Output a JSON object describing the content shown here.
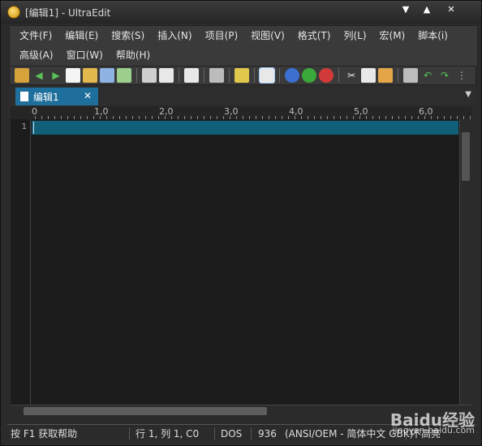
{
  "window": {
    "title": "[编辑1] - UltraEdit"
  },
  "menus": {
    "row1": [
      "文件(F)",
      "编辑(E)",
      "搜索(S)",
      "插入(N)",
      "项目(P)",
      "视图(V)",
      "格式(T)",
      "列(L)",
      "宏(M)",
      "脚本(i)"
    ],
    "row2": [
      "高级(A)",
      "窗口(W)",
      "帮助(H)"
    ]
  },
  "tab": {
    "label": "编辑1"
  },
  "ruler": {
    "labels": [
      "0",
      "1,0",
      "2,0",
      "3,0",
      "4,0",
      "5,0",
      "6,0"
    ]
  },
  "editor": {
    "line_number": "1"
  },
  "status": {
    "help": "按 F1 获取帮助",
    "position": "行 1, 列 1, C0",
    "format": "DOS",
    "encoding_code": "936",
    "encoding": "(ANSI/OEM - 简体中文 GBK)",
    "highlight": "不高亮"
  },
  "watermark": {
    "brand": "Baidu经验",
    "url": "jingyan.baidu.com"
  }
}
